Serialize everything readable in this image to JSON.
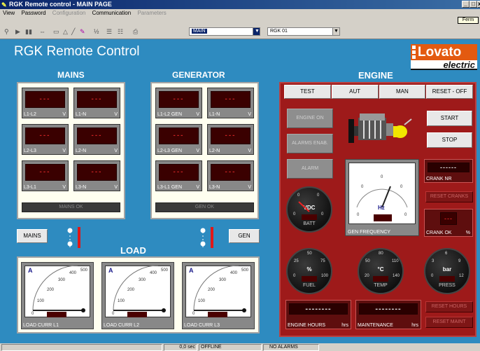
{
  "window": {
    "title": "RGK Remote control - MAIN PAGE",
    "min": "_",
    "max": "□",
    "close": "x"
  },
  "menu": [
    {
      "label": "View",
      "enabled": true
    },
    {
      "label": "Password",
      "enabled": true
    },
    {
      "label": "Configuration",
      "enabled": false
    },
    {
      "label": "Communication",
      "enabled": true
    },
    {
      "label": "Parameters",
      "enabled": false
    }
  ],
  "tooltip": "Ferm",
  "toolbar": {
    "page_select": "MAIN",
    "device_select": "RGK 01"
  },
  "app_title": "RGK Remote Control",
  "logo": {
    "line1": "Lovato",
    "line2": "electric"
  },
  "mains": {
    "heading": "MAINS",
    "cells": [
      {
        "value": "---",
        "label": "L1-L2",
        "unit": "V"
      },
      {
        "value": "---",
        "label": "L1-N",
        "unit": "V"
      },
      {
        "value": "---",
        "label": "L2-L3",
        "unit": "V"
      },
      {
        "value": "---",
        "label": "L2-N",
        "unit": "V"
      },
      {
        "value": "---",
        "label": "L3-L1",
        "unit": "V"
      },
      {
        "value": "---",
        "label": "L3-N",
        "unit": "V"
      }
    ],
    "status": "MAINS OK",
    "button": "MAINS"
  },
  "generator": {
    "heading": "GENERATOR",
    "cells": [
      {
        "value": "---",
        "label": "L1-L2 GEN",
        "unit": "V"
      },
      {
        "value": "---",
        "label": "L1-N",
        "unit": "V"
      },
      {
        "value": "---",
        "label": "L2-L3 GEN",
        "unit": "V"
      },
      {
        "value": "---",
        "label": "L2-N",
        "unit": "V"
      },
      {
        "value": "---",
        "label": "L3-L1 GEN",
        "unit": "V"
      },
      {
        "value": "---",
        "label": "L3-N",
        "unit": "V"
      }
    ],
    "status": "GEN OK",
    "button": "GEN"
  },
  "load": {
    "heading": "LOAD",
    "meters": [
      {
        "unit": "A",
        "scale": [
          "0",
          "100",
          "200",
          "300",
          "400",
          "500"
        ],
        "label": "LOAD CURR L1"
      },
      {
        "unit": "A",
        "scale": [
          "0",
          "100",
          "200",
          "300",
          "400",
          "500"
        ],
        "label": "LOAD CURR L2"
      },
      {
        "unit": "A",
        "scale": [
          "0",
          "100",
          "200",
          "300",
          "400",
          "500"
        ],
        "label": "LOAD CURR L3"
      }
    ]
  },
  "engine": {
    "heading": "ENGINE",
    "modes": [
      "TEST",
      "AUT",
      "MAN",
      "RESET - OFF"
    ],
    "leds": [
      "ENGINE ON",
      "ALARMS ENAB.",
      "ALARM"
    ],
    "start": "START",
    "stop": "STOP",
    "crank_nr": {
      "value": "------",
      "label": "CRANK NR"
    },
    "reset_cranks": "RESET CRANKS",
    "crank_ok": {
      "value": "---",
      "label": "CRANK OK",
      "unit": "%"
    },
    "gen_freq": {
      "label": "GEN FREQUENCY",
      "unit": "Hz"
    },
    "batt": {
      "label": "BATT",
      "unit": "VDC",
      "scale": [
        "0",
        "0",
        "0",
        "0"
      ]
    },
    "fuel": {
      "label": "FUEL",
      "unit": "%",
      "scale": [
        "0",
        "25",
        "50",
        "75",
        "100"
      ]
    },
    "temp": {
      "label": "TEMP",
      "unit": "°C",
      "scale": [
        "20",
        "50",
        "80",
        "110",
        "140"
      ]
    },
    "press": {
      "label": "PRESS",
      "unit": "bar",
      "scale": [
        "0",
        "3",
        "6",
        "9",
        "12"
      ]
    },
    "engine_hours": {
      "value": "--------",
      "label": "ENGINE HOURS",
      "unit": "hrs"
    },
    "maintenance": {
      "value": "--------",
      "label": "MAINTENANCE",
      "unit": "hrs"
    },
    "reset_hours": "RESET HOURS",
    "reset_maint": "RESET MAINT"
  },
  "status": {
    "time": "0,0 sec",
    "link": "OFFLINE",
    "alarms": "NO ALARMS"
  },
  "colors": {
    "background": "#2e8bc0",
    "engine_panel": "#9e1a1a",
    "display": "#3a0000",
    "segment": "#c62222"
  }
}
